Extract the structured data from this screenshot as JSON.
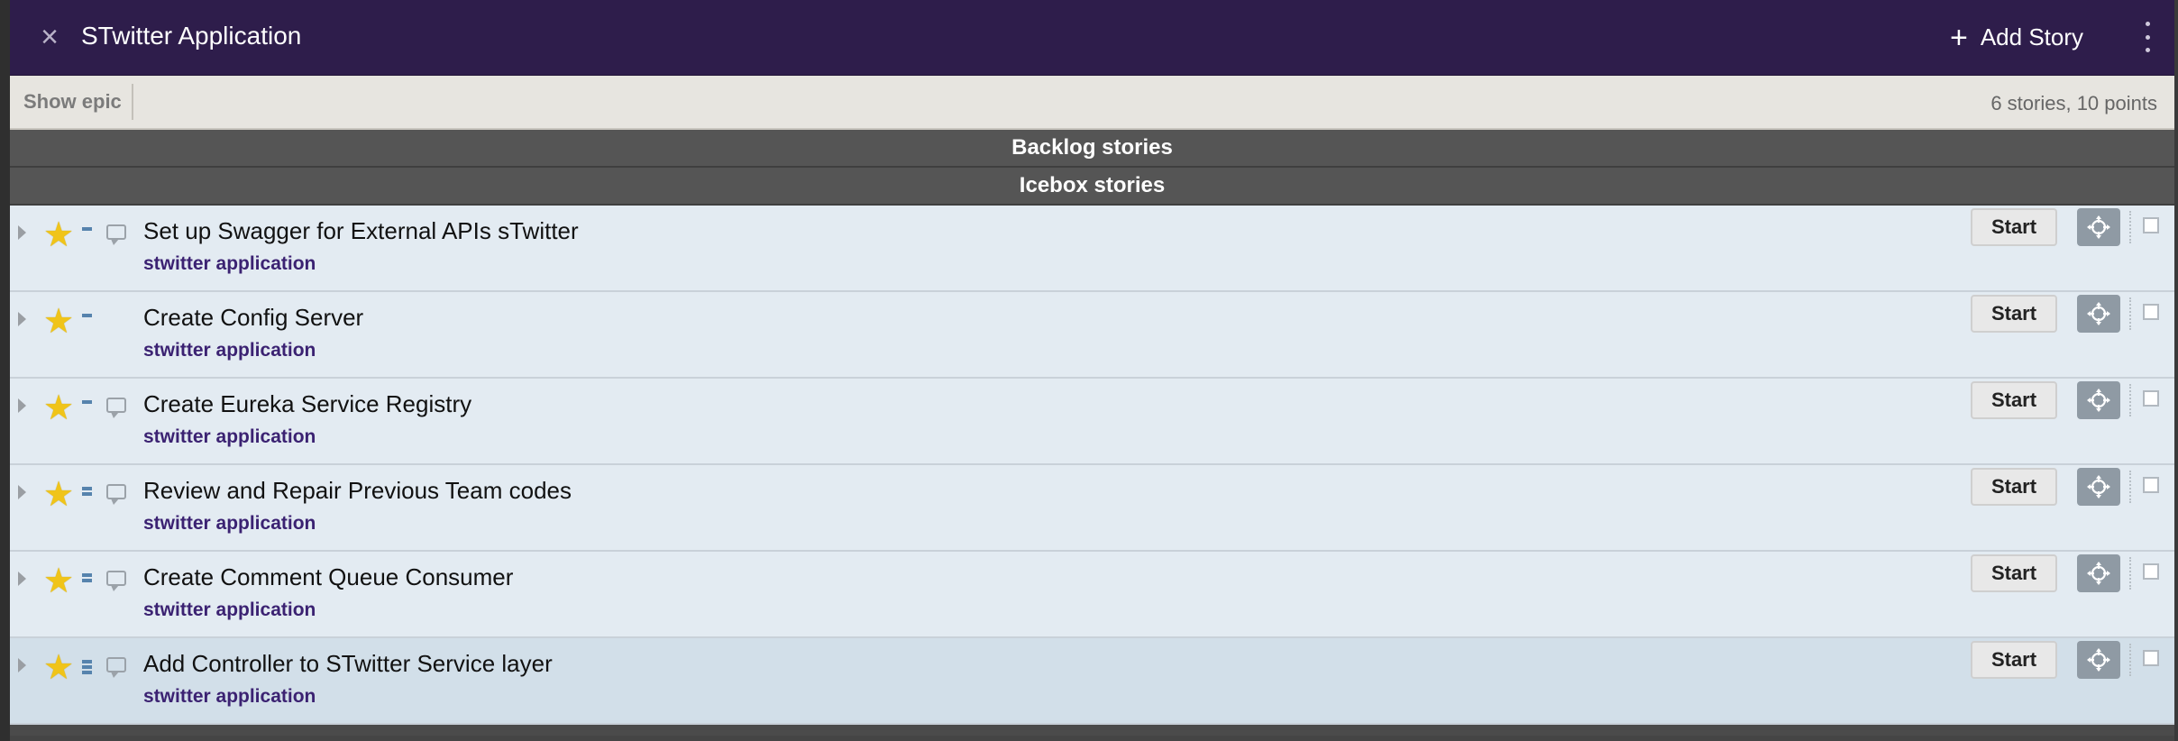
{
  "header": {
    "title": "STwitter Application",
    "close_icon": "×",
    "add_story_label": "Add Story",
    "plus_icon": "+"
  },
  "toolbar": {
    "show_epic_label": "Show epic",
    "summary": "6 stories, 10 points"
  },
  "sections": {
    "backlog_label": "Backlog stories",
    "icebox_label": "Icebox stories"
  },
  "colors": {
    "header_bg": "#2e1d4b",
    "label_color": "#3b2272",
    "star_color": "#f0c419",
    "estimate_color": "#5683ad"
  },
  "stories": [
    {
      "title": "Set up Swagger for External APIs sTwitter",
      "label": "stwitter application",
      "start_label": "Start",
      "estimate_points": 1,
      "has_comment": true
    },
    {
      "title": "Create Config Server",
      "label": "stwitter application",
      "start_label": "Start",
      "estimate_points": 1,
      "has_comment": false
    },
    {
      "title": "Create Eureka Service Registry",
      "label": "stwitter application",
      "start_label": "Start",
      "estimate_points": 1,
      "has_comment": true
    },
    {
      "title": "Review and Repair Previous Team codes",
      "label": "stwitter application",
      "start_label": "Start",
      "estimate_points": 2,
      "has_comment": true
    },
    {
      "title": "Create Comment Queue Consumer",
      "label": "stwitter application",
      "start_label": "Start",
      "estimate_points": 2,
      "has_comment": true
    },
    {
      "title": "Add Controller to STwitter Service layer",
      "label": "stwitter application",
      "start_label": "Start",
      "estimate_points": 3,
      "has_comment": true
    }
  ]
}
